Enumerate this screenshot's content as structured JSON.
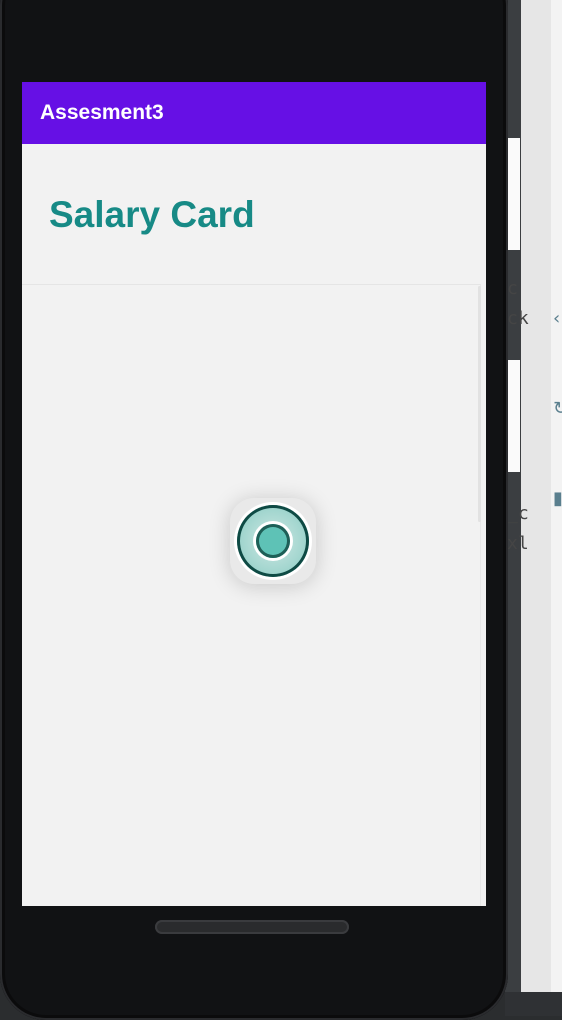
{
  "app_bar": {
    "title": "Assesment3",
    "color": "#6610e5"
  },
  "page": {
    "title": "Salary Card",
    "title_color": "#178a86"
  },
  "loader": {
    "icon": "loading-spinner-icon",
    "color": "#5ec2b6"
  },
  "ide_fragments": [
    "c",
    "ck",
    "_c",
    "xl"
  ]
}
